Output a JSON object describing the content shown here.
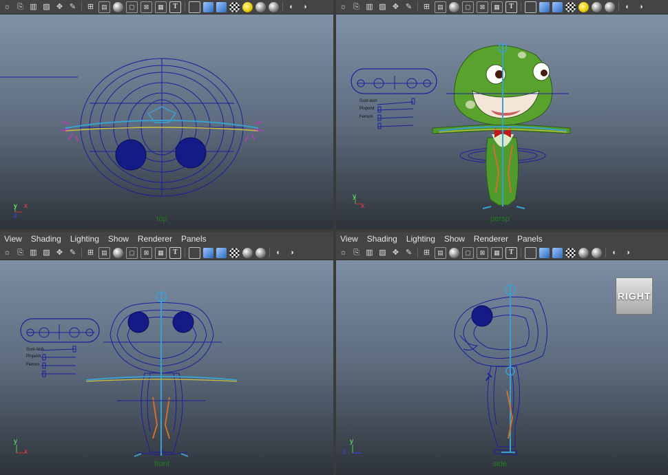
{
  "menu": [
    "View",
    "Shading",
    "Lighting",
    "Show",
    "Renderer",
    "Panels"
  ],
  "toolbar_icons": [
    "select-camera-icon",
    "camera-attributes-icon",
    "bookmark-icon",
    "image-plane-icon",
    "two-d-pan-zoom-icon",
    "grease-pencil-icon",
    "grid-icon",
    "film-gate-icon",
    "resolution-gate-icon",
    "gate-mask-icon",
    "field-chart-icon",
    "safe-action-icon",
    "safe-title-icon",
    "wireframe-icon",
    "smooth-shade-icon",
    "textured-icon",
    "use-lights-icon",
    "shadows-icon",
    "high-quality-icon",
    "isolate-select-icon",
    "xray-icon"
  ],
  "panels": {
    "top": {
      "camera_label": "top"
    },
    "persp": {
      "camera_label": "persp"
    },
    "front": {
      "camera_label": "front"
    },
    "side": {
      "camera_label": "side"
    }
  },
  "axes": {
    "y": "y",
    "x": "x",
    "z": "z"
  },
  "viewcube": {
    "label": "RIGHT"
  },
  "rig_panel": {
    "sliders": [
      "Gust-lash",
      "Pinpoint",
      "Ferrum"
    ]
  },
  "colors": {
    "viewport_top": "#8596ac",
    "viewport_bottom": "#2e333a",
    "wire": "#1a1e9c",
    "skin": "#4f9a2c",
    "joint": "#3aa0d0"
  }
}
